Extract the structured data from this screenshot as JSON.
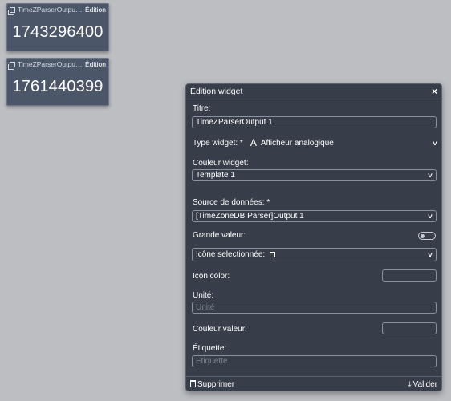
{
  "widgets": [
    {
      "title": "TimeZParserOutput...",
      "edit_label": "Édition",
      "value": "1743296400"
    },
    {
      "title": "TimeZParserOutput...",
      "edit_label": "Édition",
      "value": "1761440399"
    }
  ],
  "dialog": {
    "title": "Édition widget",
    "close": "×",
    "titre_label": "Titre:",
    "titre_value": "TimeZParserOutput 1",
    "type_label": "Type widget: *",
    "type_icon": "A",
    "type_value": "Afficheur analogique",
    "couleur_widget_label": "Couleur widget:",
    "couleur_widget_value": "Template 1",
    "source_label": "Source de données: *",
    "source_value": "[TimeZoneDB Parser]Output 1",
    "grande_valeur_label": "Grande valeur:",
    "icone_label": "Icône selectionnée:",
    "icon_color_label": "Icon color:",
    "unite_label": "Unité:",
    "unite_placeholder": "Unité",
    "couleur_valeur_label": "Couleur valeur:",
    "etiquette_label": "Étiquette:",
    "etiquette_placeholder": "Étiquette",
    "supprimer_label": "Supprimer",
    "valider_label": "Valider"
  },
  "colors": {
    "background": "#bdbec2",
    "widget_bg": "#4b5668",
    "dialog_bg": "#373e49"
  }
}
